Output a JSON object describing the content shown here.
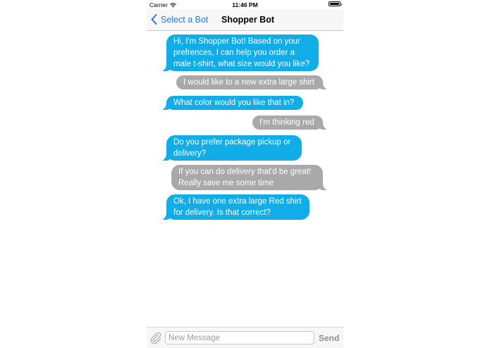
{
  "status_bar": {
    "carrier": "Carrier",
    "time": "11:46 PM"
  },
  "nav": {
    "back_label": "Select a Bot",
    "title": "Shopper Bot"
  },
  "messages": [
    {
      "sender": "bot",
      "text": "Hi, I'm Shopper Bot! Based on your prefrences, I can help you order a male t-shirt, what size would you like?"
    },
    {
      "sender": "user",
      "text": "I would like to a new extra large shirt"
    },
    {
      "sender": "bot",
      "text": "What color would you like that in?"
    },
    {
      "sender": "user",
      "text": "I'm thinking red"
    },
    {
      "sender": "bot",
      "text": "Do you prefer package pickup or delivery?"
    },
    {
      "sender": "user",
      "text": "If you can do delivery that'd be great! Really save me some time"
    },
    {
      "sender": "bot",
      "text": "Ok, I have one extra large Red shirt for delivery. Is that correct?"
    }
  ],
  "input": {
    "placeholder": "New Message",
    "value": "",
    "send_label": "Send"
  },
  "colors": {
    "bot_bubble": "#11ade9",
    "user_bubble": "#a9a9a9",
    "accent": "#157efb"
  }
}
